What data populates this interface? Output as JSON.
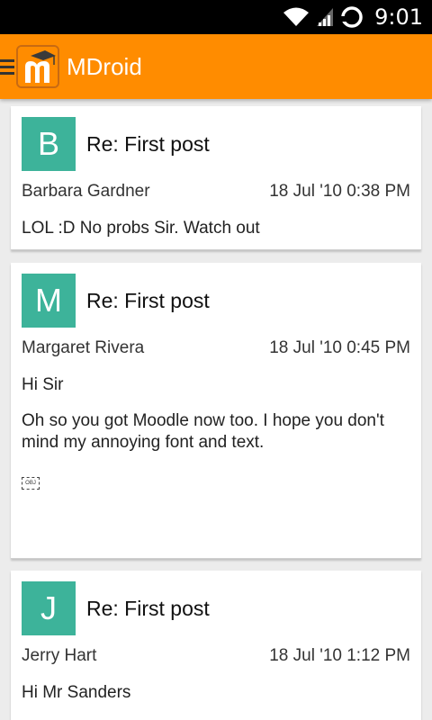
{
  "status_bar": {
    "time": "9:01",
    "icons": [
      "wifi-icon",
      "signal-icon",
      "sync-icon"
    ]
  },
  "app_bar": {
    "title": "MDroid",
    "logo_letter": "m",
    "menu_icon": "hamburger-menu-icon"
  },
  "colors": {
    "app_bar": "#ff8c00",
    "avatar": "#3db39a",
    "background": "#ececec"
  },
  "posts": [
    {
      "initial": "B",
      "subject": "Re: First post",
      "author": "Barbara Gardner",
      "date": "18 Jul '10 0:38 PM",
      "body": [
        "LOL :D No probs Sir. Watch out"
      ]
    },
    {
      "initial": "M",
      "subject": "Re: First post",
      "author": "Margaret Rivera",
      "date": "18 Jul '10 0:45 PM",
      "body": [
        "Hi Sir",
        "Oh so you got Moodle now too. I hope you don't mind my annoying font and text."
      ],
      "embedded_object_label": "OBJ"
    },
    {
      "initial": "J",
      "subject": "Re: First post",
      "author": "Jerry Hart",
      "date": "18 Jul '10 1:12 PM",
      "body": [
        "Hi Mr Sanders"
      ]
    }
  ]
}
